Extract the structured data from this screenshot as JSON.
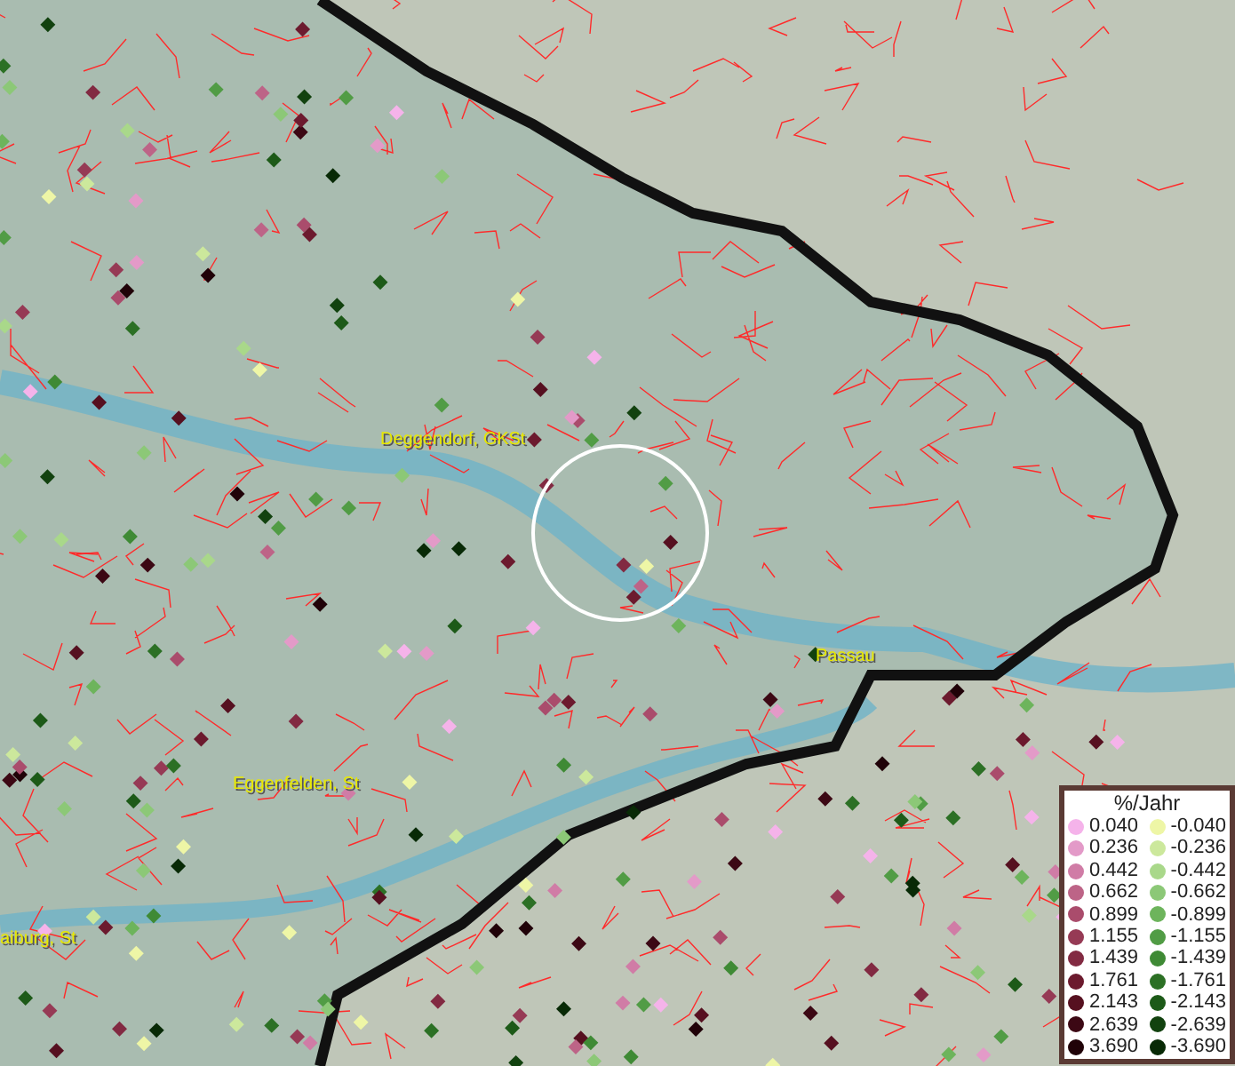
{
  "map": {
    "places": [
      {
        "name": "Deggendorf, GKSt"
      },
      {
        "name": "Passau"
      },
      {
        "name": "Eggenfelden, St"
      },
      {
        "name": "aiburg, St"
      }
    ]
  },
  "legend": {
    "title": "%/Jahr",
    "rows": [
      {
        "positive": {
          "value": "0.040",
          "color": "#f5b3ea"
        },
        "negative": {
          "value": "-0.040",
          "color": "#eef6a6"
        }
      },
      {
        "positive": {
          "value": "0.236",
          "color": "#e39ac8"
        },
        "negative": {
          "value": "-0.236",
          "color": "#cce89c"
        }
      },
      {
        "positive": {
          "value": "0.442",
          "color": "#d07ca6"
        },
        "negative": {
          "value": "-0.442",
          "color": "#a9d88a"
        }
      },
      {
        "positive": {
          "value": "0.662",
          "color": "#bd6487"
        },
        "negative": {
          "value": "-0.662",
          "color": "#8cc877"
        }
      },
      {
        "positive": {
          "value": "0.899",
          "color": "#aa4c6c"
        },
        "negative": {
          "value": "-0.899",
          "color": "#6db45c"
        }
      },
      {
        "positive": {
          "value": "1.155",
          "color": "#963a55"
        },
        "negative": {
          "value": "-1.155",
          "color": "#519c45"
        }
      },
      {
        "positive": {
          "value": "1.439",
          "color": "#822a42"
        },
        "negative": {
          "value": "-1.439",
          "color": "#3f8a35"
        }
      },
      {
        "positive": {
          "value": "1.761",
          "color": "#6c1a2e"
        },
        "negative": {
          "value": "-1.761",
          "color": "#2c7025"
        }
      },
      {
        "positive": {
          "value": "2.143",
          "color": "#561020"
        },
        "negative": {
          "value": "-2.143",
          "color": "#1d5a18"
        }
      },
      {
        "positive": {
          "value": "2.639",
          "color": "#3c0814"
        },
        "negative": {
          "value": "-2.639",
          "color": "#12420f"
        }
      },
      {
        "positive": {
          "value": "3.690",
          "color": "#200208"
        },
        "negative": {
          "value": "-3.690",
          "color": "#082a06"
        }
      }
    ]
  }
}
